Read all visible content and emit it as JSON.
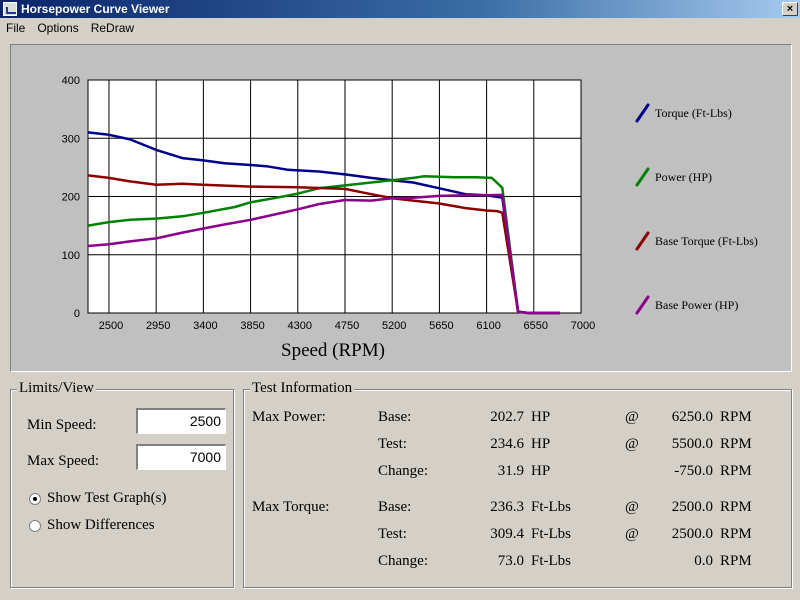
{
  "window": {
    "title": "Horsepower Curve Viewer",
    "close_glyph": "×"
  },
  "menu": [
    "File",
    "Options",
    "ReDraw"
  ],
  "chart_data": {
    "type": "line",
    "xlabel": "Speed (RPM)",
    "ylabel": "",
    "xlim": [
      2300,
      7000
    ],
    "ylim": [
      0,
      400
    ],
    "x_ticks": [
      2500,
      2950,
      3400,
      3850,
      4300,
      4750,
      5200,
      5650,
      6100,
      6550,
      7000
    ],
    "y_ticks": [
      0,
      100,
      200,
      300,
      400
    ],
    "grid": true,
    "legend_position": "right",
    "series": [
      {
        "name": "Torque (Ft-Lbs)",
        "color": "#00008b",
        "points": [
          [
            2300,
            310
          ],
          [
            2500,
            306
          ],
          [
            2700,
            298
          ],
          [
            2950,
            280
          ],
          [
            3200,
            266
          ],
          [
            3400,
            262
          ],
          [
            3600,
            257
          ],
          [
            3850,
            254
          ],
          [
            4000,
            252
          ],
          [
            4200,
            246
          ],
          [
            4500,
            243
          ],
          [
            4750,
            238
          ],
          [
            5000,
            232
          ],
          [
            5200,
            228
          ],
          [
            5400,
            224
          ],
          [
            5650,
            214
          ],
          [
            5900,
            204
          ],
          [
            6100,
            202
          ],
          [
            6250,
            198
          ],
          [
            6400,
            2
          ],
          [
            6500,
            0
          ],
          [
            6800,
            0
          ]
        ]
      },
      {
        "name": "Power (HP)",
        "color": "#008000",
        "points": [
          [
            2300,
            150
          ],
          [
            2500,
            156
          ],
          [
            2700,
            160
          ],
          [
            2950,
            162
          ],
          [
            3200,
            166
          ],
          [
            3400,
            172
          ],
          [
            3700,
            182
          ],
          [
            3850,
            190
          ],
          [
            4100,
            198
          ],
          [
            4300,
            205
          ],
          [
            4500,
            214
          ],
          [
            4750,
            219
          ],
          [
            5000,
            224
          ],
          [
            5200,
            228
          ],
          [
            5400,
            232
          ],
          [
            5500,
            234.6
          ],
          [
            5800,
            233
          ],
          [
            6000,
            233
          ],
          [
            6150,
            232
          ],
          [
            6250,
            215
          ],
          [
            6400,
            2
          ],
          [
            6500,
            0
          ],
          [
            6800,
            0
          ]
        ]
      },
      {
        "name": "Base Torque (Ft-Lbs)",
        "color": "#8b0000",
        "points": [
          [
            2300,
            236.3
          ],
          [
            2500,
            232
          ],
          [
            2700,
            226
          ],
          [
            2950,
            220
          ],
          [
            3200,
            222
          ],
          [
            3400,
            220
          ],
          [
            3850,
            217
          ],
          [
            4300,
            216
          ],
          [
            4750,
            213
          ],
          [
            5000,
            204
          ],
          [
            5200,
            197
          ],
          [
            5400,
            193
          ],
          [
            5650,
            188
          ],
          [
            5900,
            180
          ],
          [
            6100,
            176
          ],
          [
            6200,
            175
          ],
          [
            6250,
            172
          ],
          [
            6400,
            2
          ],
          [
            6500,
            0
          ],
          [
            6800,
            0
          ]
        ]
      },
      {
        "name": "Base Power (HP)",
        "color": "#8b008b",
        "points": [
          [
            2300,
            115
          ],
          [
            2500,
            118
          ],
          [
            2700,
            123
          ],
          [
            2950,
            128
          ],
          [
            3200,
            138
          ],
          [
            3400,
            145
          ],
          [
            3600,
            152
          ],
          [
            3850,
            160
          ],
          [
            4100,
            170
          ],
          [
            4300,
            178
          ],
          [
            4500,
            187
          ],
          [
            4750,
            194
          ],
          [
            5000,
            193
          ],
          [
            5200,
            197
          ],
          [
            5400,
            198
          ],
          [
            5650,
            201
          ],
          [
            5900,
            202
          ],
          [
            6100,
            202
          ],
          [
            6250,
            202.7
          ],
          [
            6400,
            2
          ],
          [
            6500,
            0
          ],
          [
            6800,
            0
          ]
        ]
      }
    ]
  },
  "limits": {
    "title": "Limits/View",
    "min_speed_label": "Min Speed:",
    "min_speed_value": "2500",
    "max_speed_label": "Max Speed:",
    "max_speed_value": "7000",
    "radio_test": "Show Test Graph(s)",
    "radio_diff": "Show Differences",
    "selected": "test"
  },
  "test_info": {
    "title": "Test Information",
    "max_power_label": "Max Power:",
    "max_torque_label": "Max Torque:",
    "rows": [
      {
        "label": "Base:",
        "value": "202.7",
        "unit": "HP",
        "at": "@",
        "rpm": "6250.0",
        "rpm_unit": "RPM"
      },
      {
        "label": "Test:",
        "value": "234.6",
        "unit": "HP",
        "at": "@",
        "rpm": "5500.0",
        "rpm_unit": "RPM"
      },
      {
        "label": "Change:",
        "value": "31.9",
        "unit": "HP",
        "at": "",
        "rpm": "-750.0",
        "rpm_unit": "RPM"
      },
      {
        "label": "Base:",
        "value": "236.3",
        "unit": "Ft-Lbs",
        "at": "@",
        "rpm": "2500.0",
        "rpm_unit": "RPM"
      },
      {
        "label": "Test:",
        "value": "309.4",
        "unit": "Ft-Lbs",
        "at": "@",
        "rpm": "2500.0",
        "rpm_unit": "RPM"
      },
      {
        "label": "Change:",
        "value": "73.0",
        "unit": "Ft-Lbs",
        "at": "",
        "rpm": "0.0",
        "rpm_unit": "RPM"
      }
    ]
  }
}
